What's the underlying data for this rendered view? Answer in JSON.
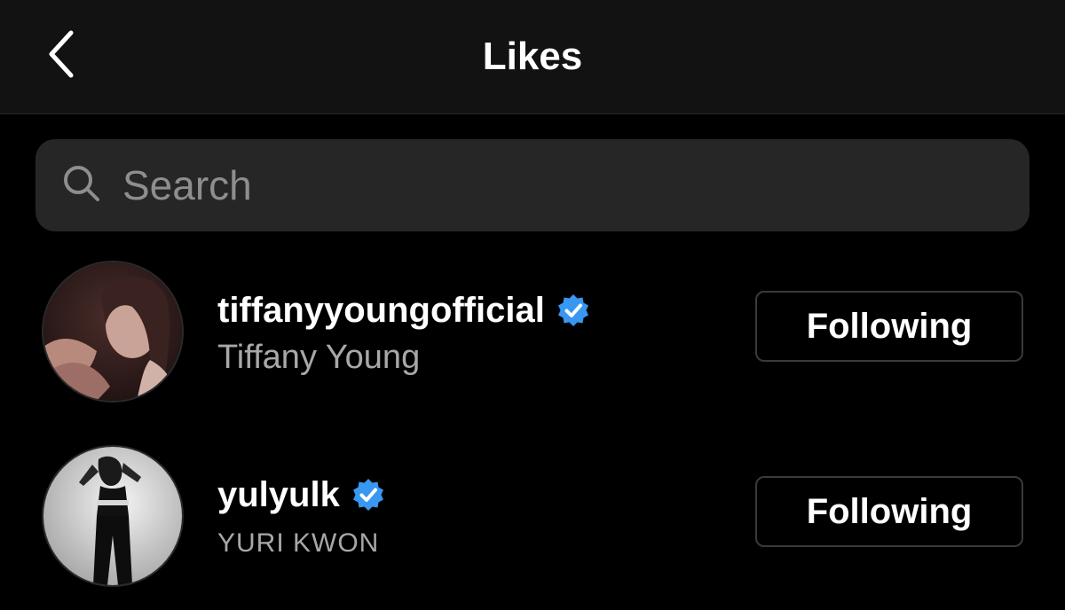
{
  "header": {
    "title": "Likes",
    "back_icon": "chevron-left-icon"
  },
  "search": {
    "placeholder": "Search",
    "value": "",
    "icon": "search-icon"
  },
  "likes": [
    {
      "username": "tiffanyyoungofficial",
      "full_name": "Tiffany Young",
      "verified": true,
      "follow_label": "Following",
      "avatar": "profile-photo"
    },
    {
      "username": "yulyulk",
      "full_name": "YURI KWON",
      "verified": true,
      "follow_label": "Following",
      "avatar": "profile-photo"
    }
  ],
  "colors": {
    "background": "#000000",
    "header": "#121212",
    "search_bg": "#262626",
    "secondary_text": "#a8a8a8",
    "verified_blue": "#3897f0",
    "button_border": "#3a3a3a"
  }
}
